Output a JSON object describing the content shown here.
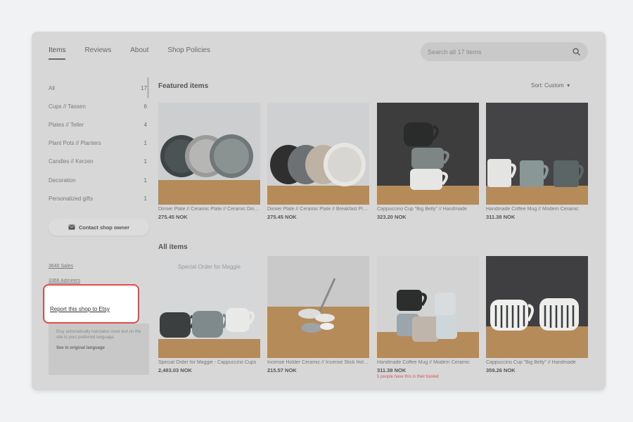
{
  "nav": {
    "tabs": [
      {
        "label": "Items",
        "active": true
      },
      {
        "label": "Reviews",
        "active": false
      },
      {
        "label": "About",
        "active": false
      },
      {
        "label": "Shop Policies",
        "active": false
      }
    ],
    "search_placeholder": "Search all 17 items"
  },
  "sidebar": {
    "categories": [
      {
        "label": "All",
        "count": "17"
      },
      {
        "label": "Cups // Tassen",
        "count": "6"
      },
      {
        "label": "Plates // Teller",
        "count": "4"
      },
      {
        "label": "Plant Pots // Planters",
        "count": "1"
      },
      {
        "label": "Candles // Kerzen",
        "count": "1"
      },
      {
        "label": "Decoration",
        "count": "1"
      },
      {
        "label": "Personalized gifts",
        "count": "1"
      }
    ],
    "contact_label": "Contact shop owner",
    "sales": "3640 Sales",
    "admirers": "3366 Admirers",
    "report_label": "Report this shop to Etsy",
    "translate_text": "Etsy automatically translates most text on the site to your preferred language.",
    "see_original": "See in original language"
  },
  "main": {
    "featured_title": "Featured items",
    "sort_label": "Sort: Custom",
    "all_title": "All items",
    "featured": [
      {
        "title": "Dinner Plate // Ceramic Plate // Ceramic Dinnerware",
        "price": "275.45 NOK"
      },
      {
        "title": "Dinner Plate // Ceramic Plate // Breakfast Plate",
        "price": "275.45 NOK"
      },
      {
        "title": "Cappuccino Cup \"Big Belly\" // Handmade",
        "price": "323.20 NOK"
      },
      {
        "title": "Handmade Coffee Mug // Modern Ceramic",
        "price": "311.38 NOK"
      }
    ],
    "all": [
      {
        "title": "Special Order for Maggie - Cappuccino Cups",
        "price": "2,483.03 NOK",
        "overlay": "Special Order for Maggie"
      },
      {
        "title": "Incense Holder Ceramic // Incense Stick Holder",
        "price": "215.57 NOK"
      },
      {
        "title": "Handmade Coffee Mug // Modern Ceramic",
        "price": "311.38 NOK",
        "note": "5 people have this in their basket"
      },
      {
        "title": "Cappuccino Cup \"Big Belly\" // Handmade",
        "price": "359.26 NOK"
      }
    ]
  }
}
